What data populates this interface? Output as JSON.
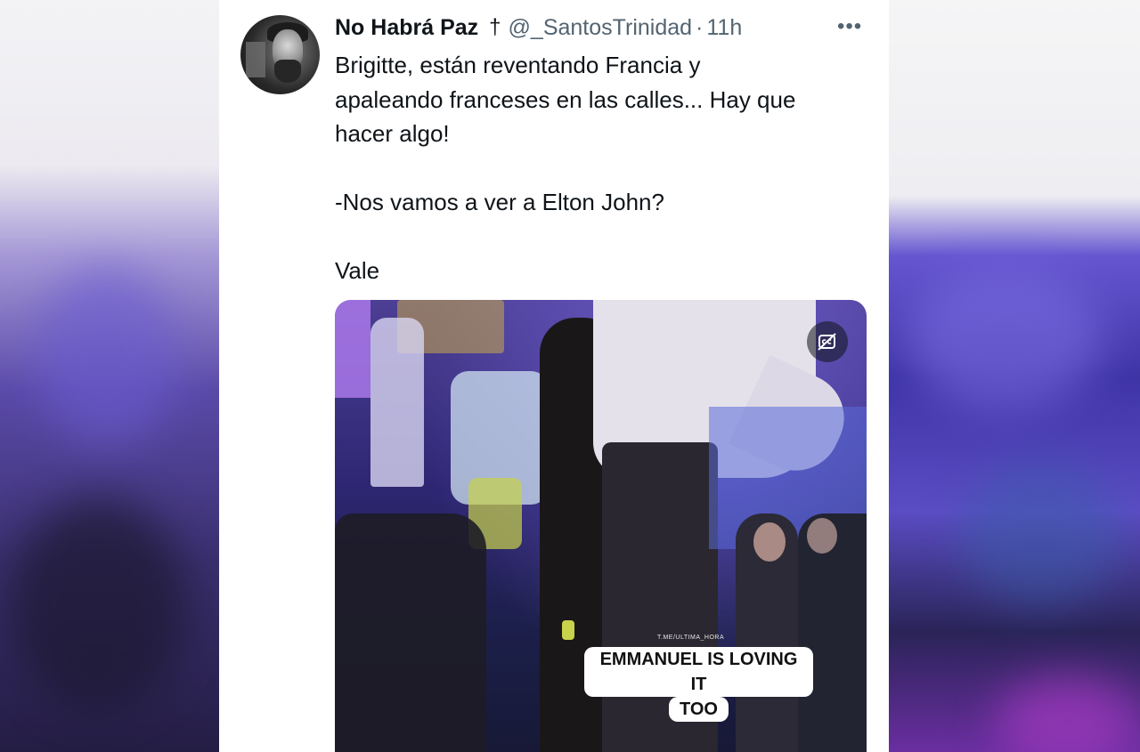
{
  "tweet": {
    "display_name": "No Habrá Paz",
    "badge": "†",
    "handle": "@_SantosTrinidad",
    "separator": "·",
    "time": "11h",
    "more": "•••",
    "text": "Brigitte, están reventando Francia y\napaleando franceses en las calles... Hay que\nhacer algo!\n\n-Nos vamos a ver a Elton John?\n\nVale"
  },
  "media": {
    "watermark": "T.ME/ULTIMA_HORA",
    "caption_line1": "EMMANUEL IS LOVING IT",
    "caption_line2": "TOO"
  },
  "icons": {
    "more": "more-horizontal-icon",
    "captions": "captions-off-icon"
  }
}
